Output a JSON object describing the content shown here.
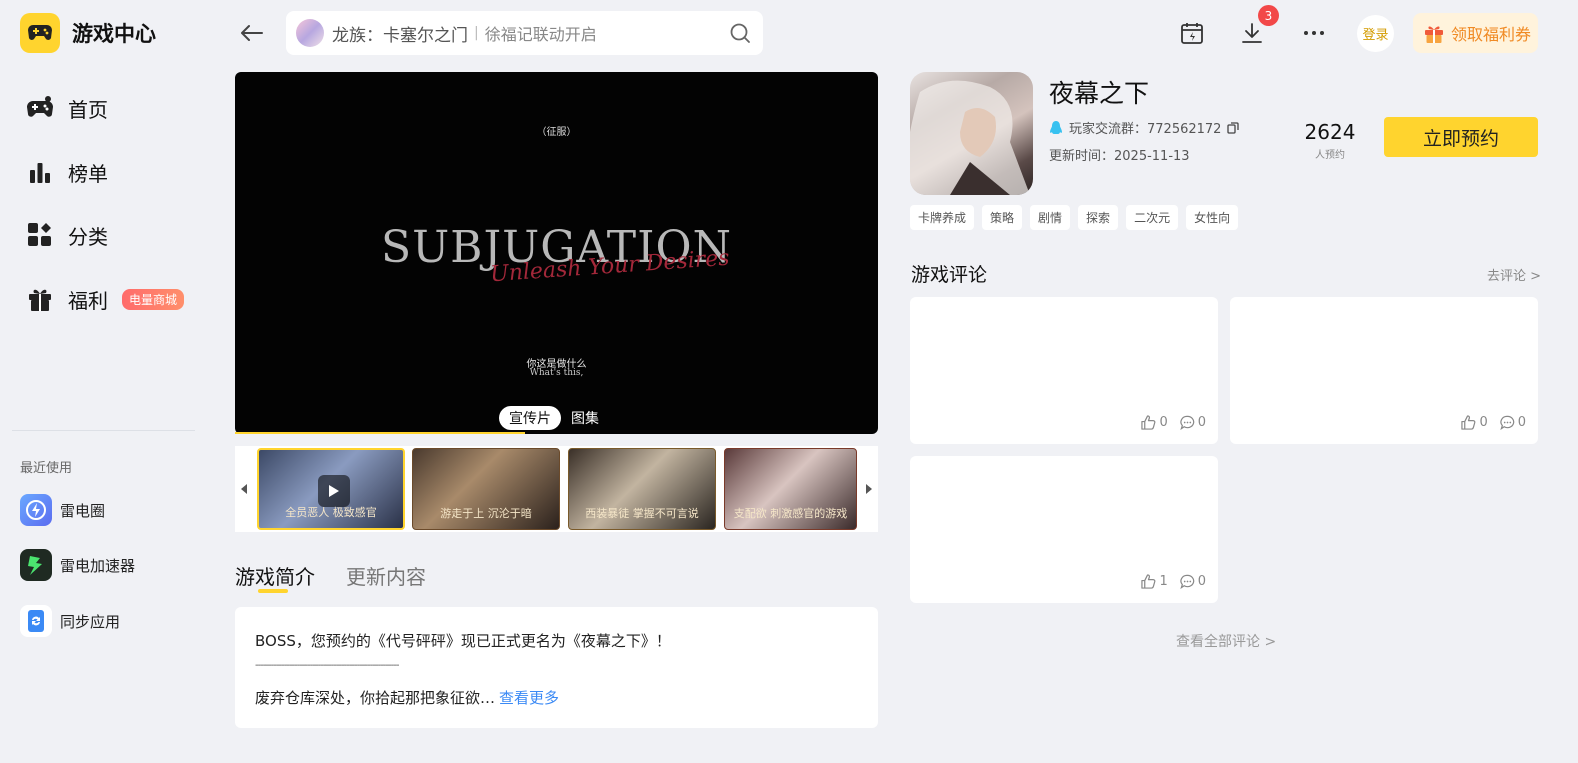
{
  "app": {
    "title": "游戏中心"
  },
  "nav": {
    "items": [
      {
        "label": "首页",
        "icon": "gamepad-icon"
      },
      {
        "label": "榜单",
        "icon": "chart-icon"
      },
      {
        "label": "分类",
        "icon": "category-icon"
      },
      {
        "label": "福利",
        "icon": "gift-icon",
        "badge": "电量商城"
      }
    ]
  },
  "recent": {
    "title": "最近使用",
    "items": [
      {
        "label": "雷电圈",
        "icon": "leidian-circle-icon"
      },
      {
        "label": "雷电加速器",
        "icon": "accelerator-icon"
      },
      {
        "label": "同步应用",
        "icon": "sync-app-icon"
      }
    ]
  },
  "search": {
    "main": "龙族：卡塞尔之门",
    "sep": "|",
    "sub": "徐福记联动开启"
  },
  "topbar": {
    "download_count": "3",
    "login_label": "登录",
    "welfare_label": "领取福利券"
  },
  "video": {
    "caption_top": "（征服）",
    "title": "SUBJUGATION",
    "script": "Unleash Your Desires",
    "subtitle_cn": "你这是做什么",
    "subtitle_en": "What's this,",
    "tabs": [
      "宣传片",
      "图集"
    ]
  },
  "thumbnails": [
    {
      "caption": "全员恶人 极致感官",
      "type": "video"
    },
    {
      "caption": "游走于上 沉沦于暗",
      "type": "image"
    },
    {
      "caption": "西装暴徒 掌握不可言说",
      "type": "image"
    },
    {
      "caption": "支配欲 刺激感官的游戏",
      "type": "image"
    }
  ],
  "tabs": {
    "intro": "游戏简介",
    "update": "更新内容"
  },
  "intro": {
    "line1": "BOSS，您预约的《代号砰砰》现已正式更名为《夜幕之下》！",
    "dash": "-------------------------------------------------------",
    "line2": "废弃仓库深处，你拾起那把象征欲…",
    "more": "查看更多"
  },
  "game": {
    "name": "夜幕之下",
    "qq_group": "玩家交流群：772562172",
    "update_time": "更新时间：2025-11-13",
    "reserve_count": "2624",
    "reserve_count_label": "人预约",
    "reserve_button": "立即预约",
    "tags": [
      "卡牌养成",
      "策略",
      "剧情",
      "探索",
      "二次元",
      "女性向"
    ]
  },
  "comments": {
    "title": "游戏评论",
    "go": "去评论 >",
    "view_all": "查看全部评论 >",
    "items": [
      {
        "likes": "0",
        "replies": "0"
      },
      {
        "likes": "0",
        "replies": "0"
      },
      {
        "likes": "1",
        "replies": "0"
      }
    ]
  },
  "colors": {
    "accent": "#ffd42e",
    "link": "#3b8af5",
    "badge_red": "#f24848",
    "welfare_orange": "#f08a24"
  }
}
